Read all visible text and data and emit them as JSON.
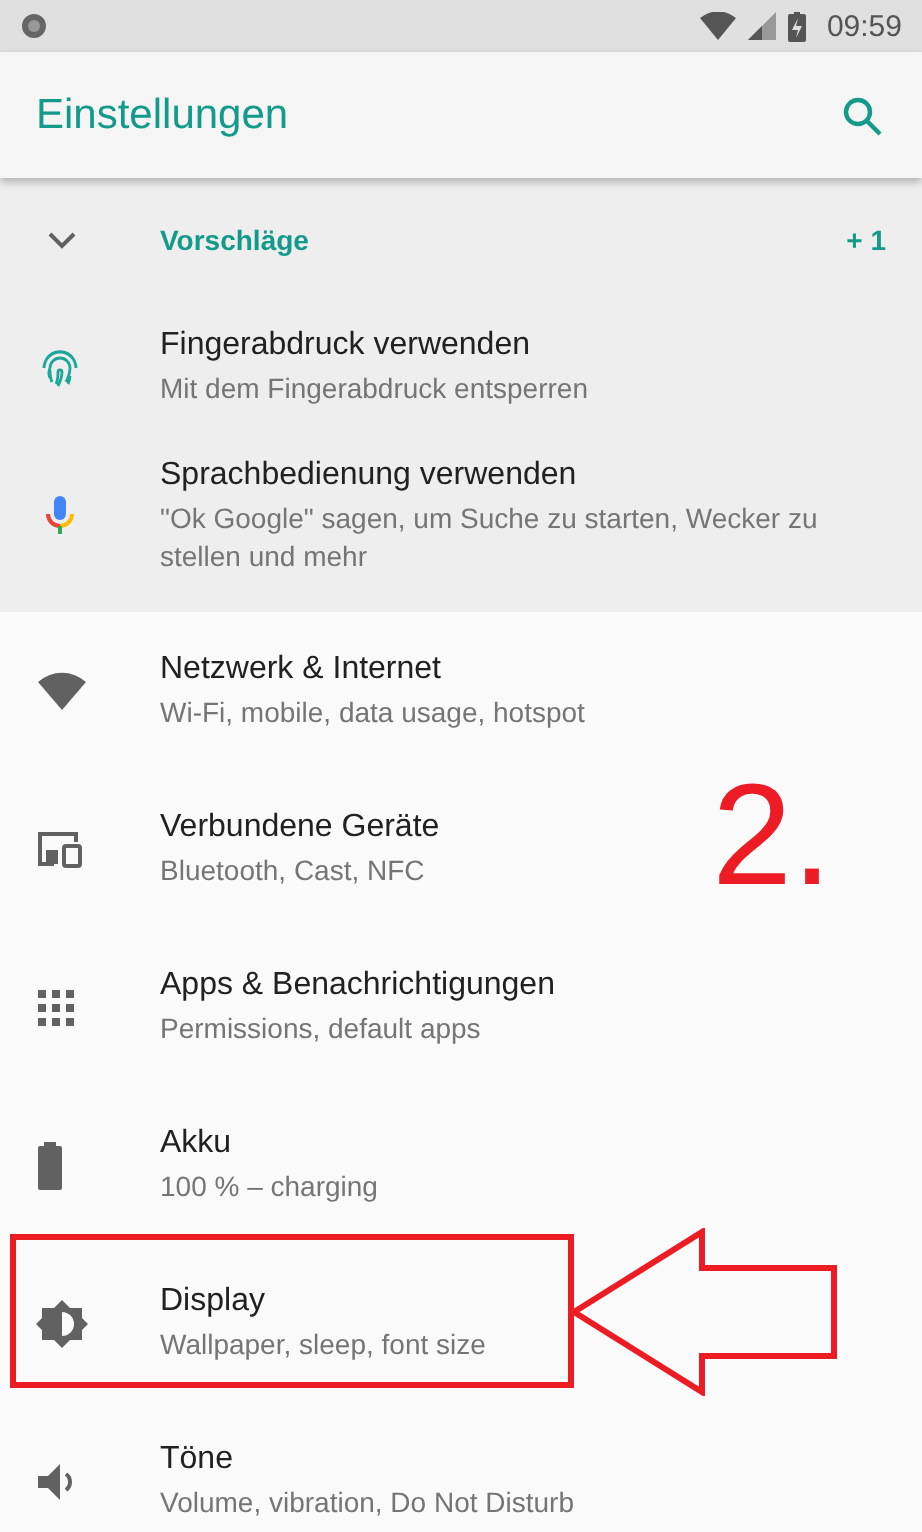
{
  "status_bar": {
    "time": "09:59"
  },
  "app_bar": {
    "title": "Einstellungen"
  },
  "suggestions": {
    "label": "Vorschläge",
    "count": "+ 1",
    "expanded": true,
    "items": [
      {
        "title": "Fingerabdruck verwenden",
        "subtitle": "Mit dem Fingerabdruck entsperren"
      },
      {
        "title": "Sprachbedienung verwenden",
        "subtitle": "\"Ok Google\" sagen, um Suche zu starten, Wecker zu stellen und mehr"
      }
    ]
  },
  "items": [
    {
      "title": "Netzwerk & Internet",
      "subtitle": "Wi-Fi, mobile, data usage, hotspot",
      "highlighted": false
    },
    {
      "title": "Verbundene Geräte",
      "subtitle": "Bluetooth, Cast, NFC",
      "highlighted": false
    },
    {
      "title": "Apps & Benachrichtigungen",
      "subtitle": "Permissions, default apps",
      "highlighted": false
    },
    {
      "title": "Akku",
      "subtitle": "100 % – charging",
      "highlighted": false
    },
    {
      "title": "Display",
      "subtitle": "Wallpaper, sleep, font size",
      "highlighted": true
    },
    {
      "title": "Töne",
      "subtitle": "Volume, vibration, Do Not Disturb",
      "highlighted": false
    }
  ],
  "annotation": {
    "step_label": "2."
  }
}
